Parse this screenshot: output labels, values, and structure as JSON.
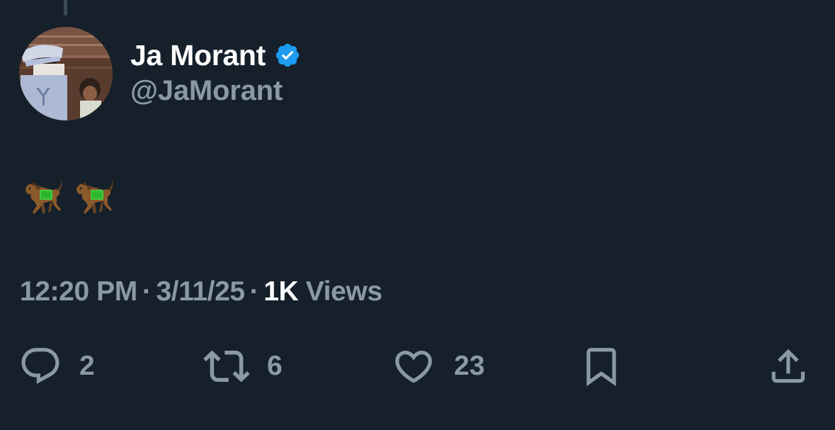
{
  "tweet": {
    "author": {
      "display_name": "Ja Morant",
      "handle": "@JaMorant",
      "verified": true
    },
    "text_emoji": [
      "horse-racing",
      "horse-racing"
    ],
    "time": "12:20 PM",
    "date": "3/11/25",
    "views_count": "1K",
    "views_label": "Views",
    "separator": "·"
  },
  "actions": {
    "replies": "2",
    "retweets": "6",
    "likes": "23"
  },
  "colors": {
    "background": "#15202b",
    "text_primary": "#ffffff",
    "text_secondary": "#8b98a5",
    "verified_blue": "#1d9bf0"
  }
}
